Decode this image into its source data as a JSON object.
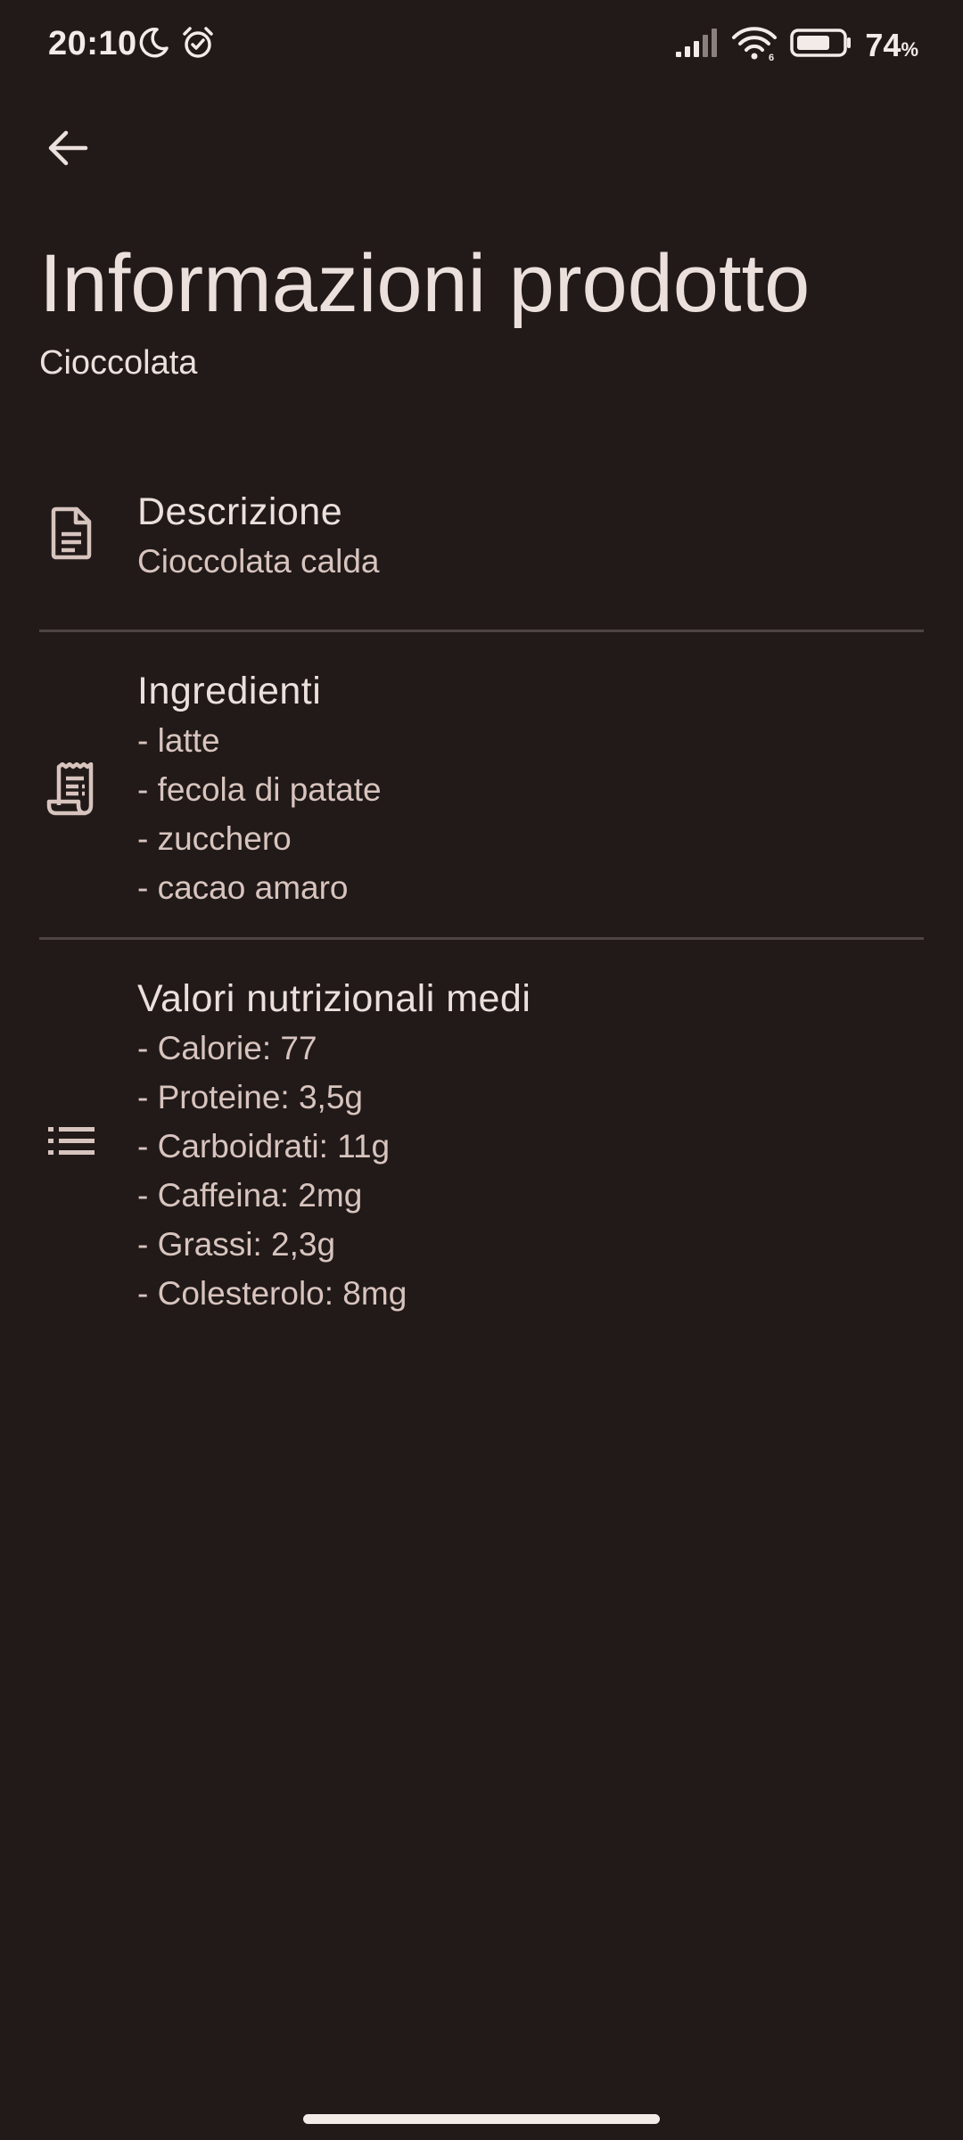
{
  "status_bar": {
    "time": "20:10",
    "battery_value": "74",
    "battery_unit": "%",
    "battery_level": 0.74,
    "icons": [
      "moon-icon",
      "alarm-icon",
      "signal-icon",
      "wifi-icon",
      "battery-icon"
    ]
  },
  "header": {
    "back_icon": "arrow-back-icon",
    "title": "Informazioni prodotto",
    "subtitle": "Cioccolata"
  },
  "sections": {
    "description": {
      "icon": "document-icon",
      "heading": "Descrizione",
      "lines": [
        "Cioccolata calda"
      ]
    },
    "ingredients": {
      "icon": "receipt-icon",
      "heading": "Ingredienti",
      "lines": [
        "- latte",
        "- fecola di patate",
        "- zucchero",
        "- cacao amaro"
      ]
    },
    "nutrition": {
      "icon": "list-icon",
      "heading": "Valori nutrizionali medi",
      "lines": [
        "- Calorie: 77",
        "- Proteine: 3,5g",
        "- Carboidrati: 11g",
        "- Caffeina: 2mg",
        "- Grassi: 2,3g",
        "- Colesterolo: 8mg"
      ]
    }
  },
  "colors": {
    "background": "#211a19",
    "text_primary": "#ece0dc",
    "text_secondary": "#d8c4be",
    "divider": "#4e4543"
  }
}
